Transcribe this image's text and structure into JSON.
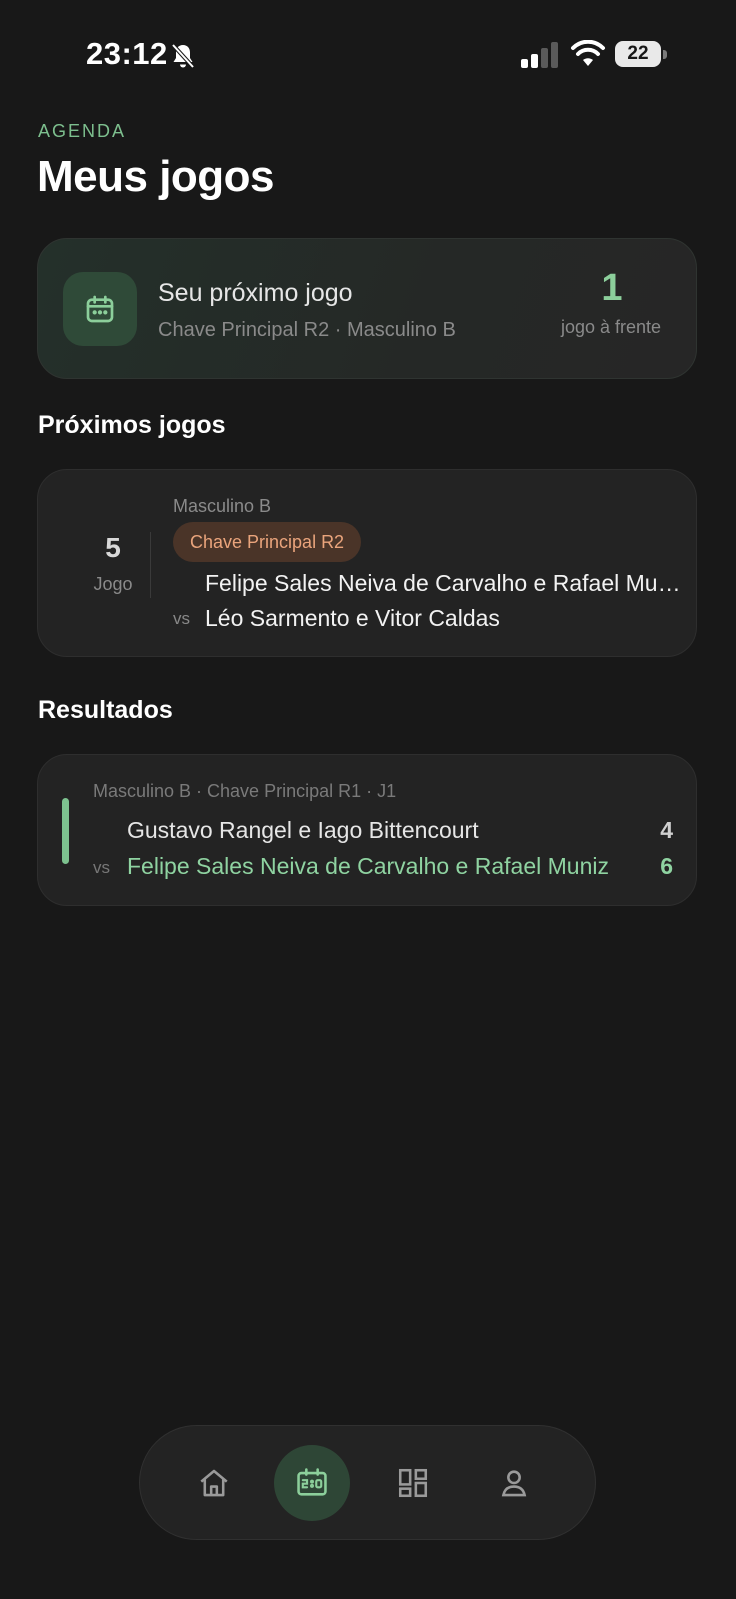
{
  "status_bar": {
    "time": "23:12",
    "battery": "22"
  },
  "header": {
    "overline": "AGENDA",
    "title": "Meus jogos"
  },
  "next_game_card": {
    "title": "Seu próximo jogo",
    "subtitle": "Chave Principal R2 · Masculino B",
    "count": "1",
    "count_label": "jogo à frente"
  },
  "upcoming": {
    "section_title": "Próximos jogos",
    "games": [
      {
        "number": "5",
        "number_label": "Jogo",
        "category": "Masculino B",
        "round": "Chave Principal R2",
        "team_a": "Felipe Sales Neiva de Carvalho e Rafael Muniz",
        "vs": "vs",
        "team_b": "Léo Sarmento e Vitor Caldas"
      }
    ]
  },
  "results": {
    "section_title": "Resultados",
    "items": [
      {
        "meta": "Masculino B · Chave Principal R1 · J1",
        "team_a": "Gustavo Rangel e Iago Bittencourt",
        "score_a": "4",
        "vs": "vs",
        "team_b": "Felipe Sales Neiva de Carvalho e Rafael Muniz",
        "score_b": "6"
      }
    ]
  },
  "bottom_nav": {
    "items": [
      {
        "icon": "home-icon",
        "active": false
      },
      {
        "icon": "scoreboard-icon",
        "active": true
      },
      {
        "icon": "dashboard-icon",
        "active": false
      },
      {
        "icon": "user-icon",
        "active": false
      }
    ]
  },
  "colors": {
    "accent": "#8ccf9b",
    "background": "#181818",
    "card": "#232323",
    "badge_text": "#eaa47c"
  }
}
